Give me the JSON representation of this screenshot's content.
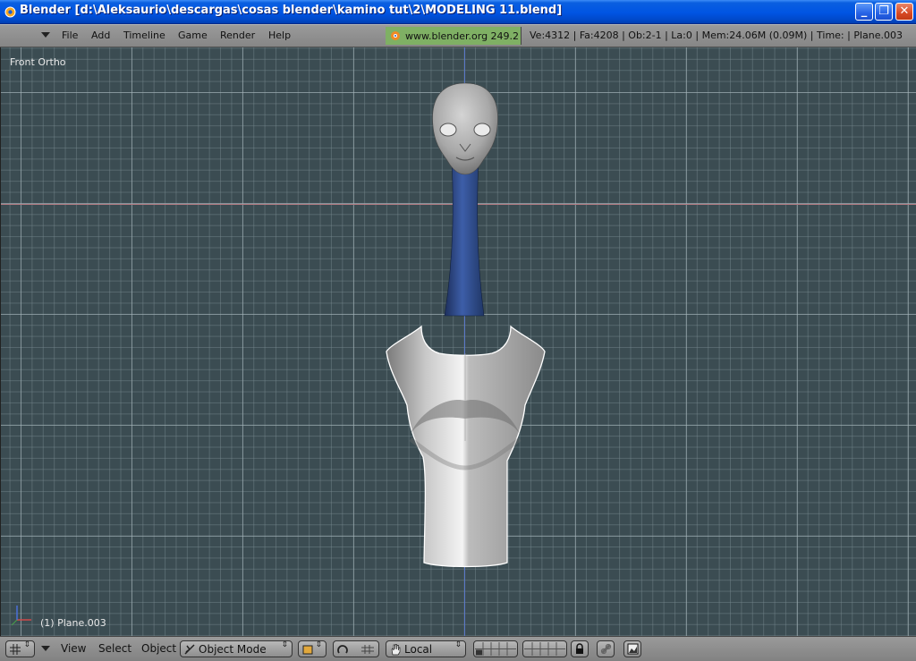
{
  "window": {
    "title": "Blender [d:\\Aleksaurio\\descargas\\cosas blender\\kamino tut\\2\\MODELING 11.blend]",
    "minimize_label": "_",
    "maximize_label": "❐",
    "close_label": "✕"
  },
  "menu": {
    "items": [
      {
        "label": "File"
      },
      {
        "label": "Add"
      },
      {
        "label": "Timeline"
      },
      {
        "label": "Game"
      },
      {
        "label": "Render"
      },
      {
        "label": "Help"
      }
    ],
    "url": "www.blender.org 249.2",
    "stats": "Ve:4312 | Fa:4208 | Ob:2-1 | La:0  | Mem:24.06M (0.09M)  | Time: | Plane.003"
  },
  "viewport": {
    "view_name": "Front Ortho",
    "object_label": "(1) Plane.003",
    "background_color": "#3b4c52",
    "x_axis_color": "#b27a82",
    "z_axis_color": "#5a78c8"
  },
  "bottom": {
    "menus": [
      {
        "label": "View"
      },
      {
        "label": "Select"
      },
      {
        "label": "Object"
      }
    ],
    "mode": "Object Mode",
    "pivot": "Local"
  },
  "icons": {
    "app": "blender-logo-icon",
    "viewport_type": "grid-icon",
    "mode": "object-mode-icon",
    "draw_type": "solid-shading-icon",
    "manipulator": "rotate-manipulator-icon",
    "transform_orientation": "hand-icon",
    "layers": "layers-icon",
    "lock": "lock-icon",
    "link": "link-icon",
    "render": "render-icon"
  }
}
